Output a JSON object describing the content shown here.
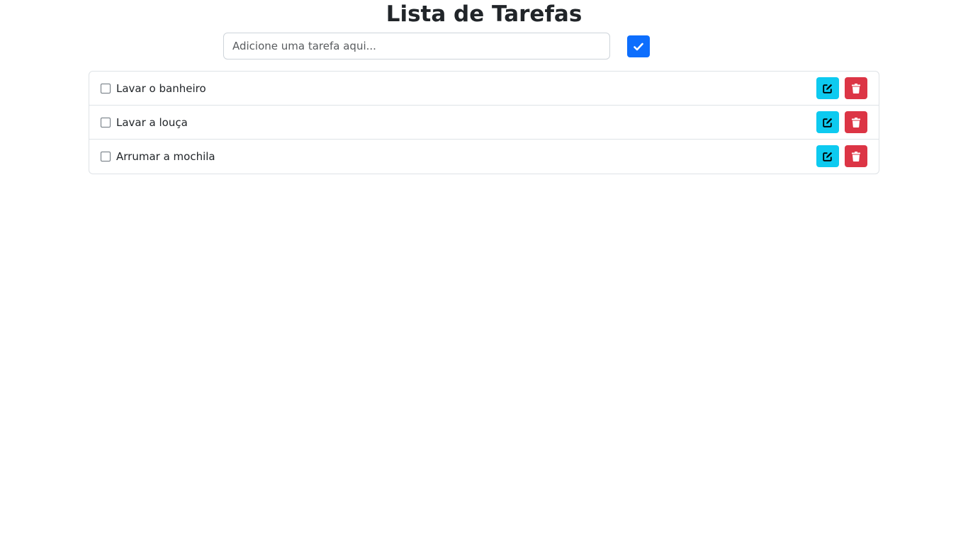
{
  "header": {
    "title": "Lista de Tarefas"
  },
  "add_task": {
    "placeholder": "Adicione uma tarefa aqui...",
    "value": "",
    "button_icon": "check-icon"
  },
  "tasks": [
    {
      "text": "Lavar o banheiro",
      "checked": false
    },
    {
      "text": "Lavar a louça",
      "checked": false
    },
    {
      "text": "Arrumar a mochila",
      "checked": false
    }
  ],
  "task_actions": {
    "edit_icon": "edit-icon",
    "delete_icon": "trash-icon"
  },
  "colors": {
    "primary": "#0d6efd",
    "info": "#0dcaf0",
    "danger": "#dc3545",
    "border": "#dee2e6",
    "text": "#212529"
  }
}
